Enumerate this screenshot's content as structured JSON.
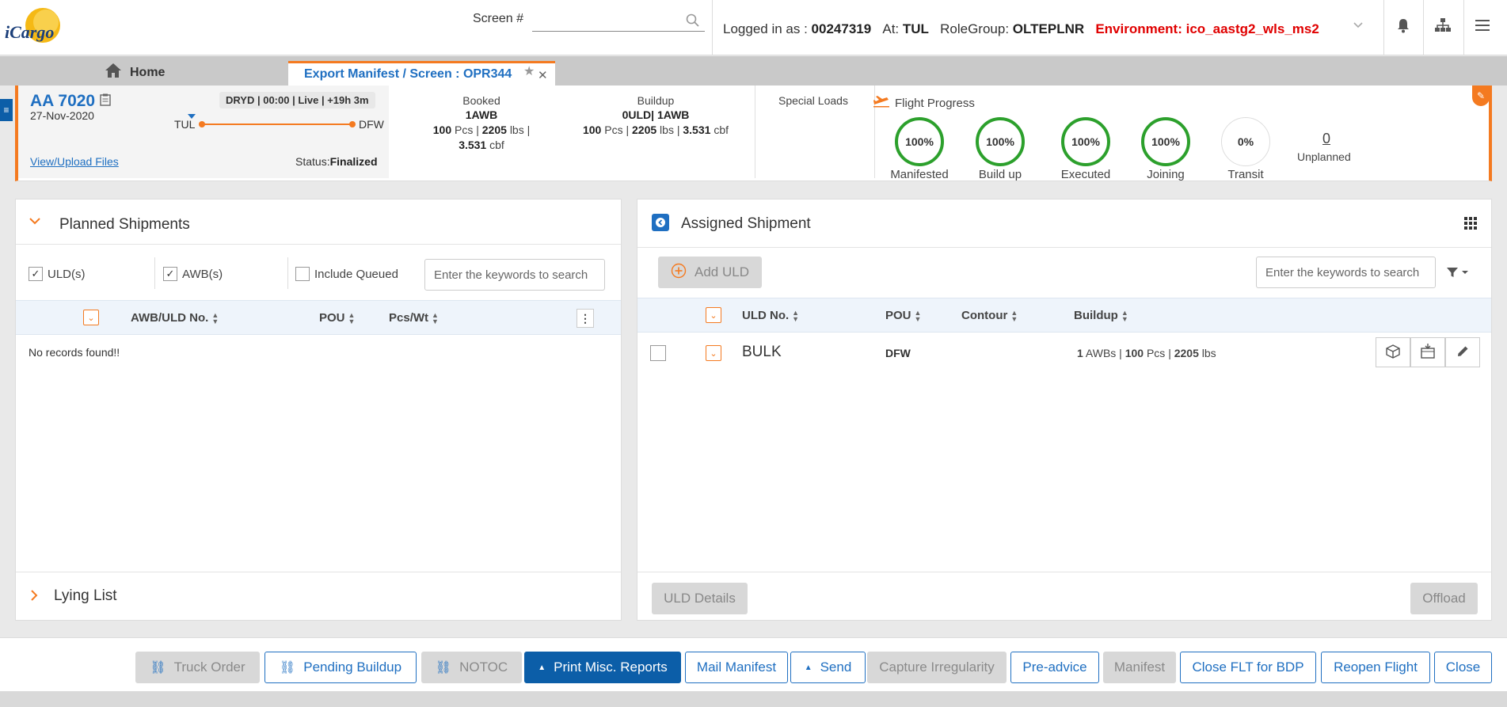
{
  "header": {
    "logo_text": "iCargo",
    "screen_label": "Screen #",
    "screen_value": "",
    "logged_in_label": "Logged in as :",
    "user_id": "00247319",
    "at_label": "At:",
    "station": "TUL",
    "rolegroup_label": "RoleGroup:",
    "rolegroup": "OLTEPLNR",
    "environment": "Environment: ico_aastg2_wls_ms2"
  },
  "tabs": {
    "home": "Home",
    "active": "Export Manifest / Screen : OPR344"
  },
  "flight": {
    "number": "AA 7020",
    "date": "27-Nov-2020",
    "badge": "DRYD | 00:00 | Live | +19h 3m",
    "origin": "TUL",
    "destination": "DFW",
    "view_upload": "View/Upload Files",
    "status_label": "Status:",
    "status_value": "Finalized",
    "booked": {
      "label": "Booked",
      "awb": "1AWB",
      "pcs": "100",
      "pcs_unit": "Pcs |",
      "wt": "2205",
      "wt_unit": "lbs |",
      "vol": "3.531",
      "vol_unit": "cbf"
    },
    "buildup": {
      "label": "Buildup",
      "uld_line": "0ULD| 1AWB",
      "pcs": "100",
      "pcs_unit": "Pcs |",
      "wt": "2205",
      "wt_unit": "lbs |",
      "vol": "3.531",
      "vol_unit": "cbf"
    },
    "special_loads": "Special Loads",
    "progress_title": "Flight Progress",
    "progress": [
      {
        "label": "Manifested",
        "value": "100%",
        "percent": 100
      },
      {
        "label": "Build up",
        "value": "100%",
        "percent": 100
      },
      {
        "label": "Executed",
        "value": "100%",
        "percent": 100
      },
      {
        "label": "Joining",
        "value": "100%",
        "percent": 100
      },
      {
        "label": "Transit",
        "value": "0%",
        "percent": 0
      }
    ],
    "unplanned_value": "0",
    "unplanned_label": "Unplanned"
  },
  "planned": {
    "title": "Planned Shipments",
    "filter_ulds": "ULD(s)",
    "filter_awbs": "AWB(s)",
    "filter_queued": "Include Queued",
    "search_placeholder": "Enter the keywords to search",
    "columns": [
      "AWB/ULD No.",
      "POU",
      "Pcs/Wt"
    ],
    "empty": "No records found!!",
    "lying_list": "Lying List"
  },
  "assigned": {
    "title": "Assigned Shipment",
    "add_uld": "Add ULD",
    "search_placeholder": "Enter the keywords to search",
    "columns": [
      "ULD No.",
      "POU",
      "Contour",
      "Buildup"
    ],
    "rows": [
      {
        "uld": "BULK",
        "pou": "DFW",
        "contour": "",
        "awbs": "1",
        "awbs_unit": "AWBs |",
        "pcs": "100",
        "pcs_unit": "Pcs |",
        "wt": "2205",
        "wt_unit": "lbs"
      }
    ],
    "uld_details": "ULD Details",
    "offload": "Offload"
  },
  "footer": {
    "truck_order": "Truck Order",
    "pending_buildup": "Pending Buildup",
    "notoc": "NOTOC",
    "print_misc": "Print Misc. Reports",
    "mail_manifest": "Mail Manifest",
    "send": "Send",
    "capture_irregularity": "Capture Irregularity",
    "pre_advice": "Pre-advice",
    "manifest": "Manifest",
    "close_flt": "Close FLT for BDP",
    "reopen_flight": "Reopen Flight",
    "close": "Close"
  },
  "colors": {
    "brand_orange": "#f47a20",
    "link_blue": "#1f6fc1",
    "primary_blue": "#0c5ea8",
    "env_red": "#e00000",
    "progress_green": "#2ca02c"
  }
}
